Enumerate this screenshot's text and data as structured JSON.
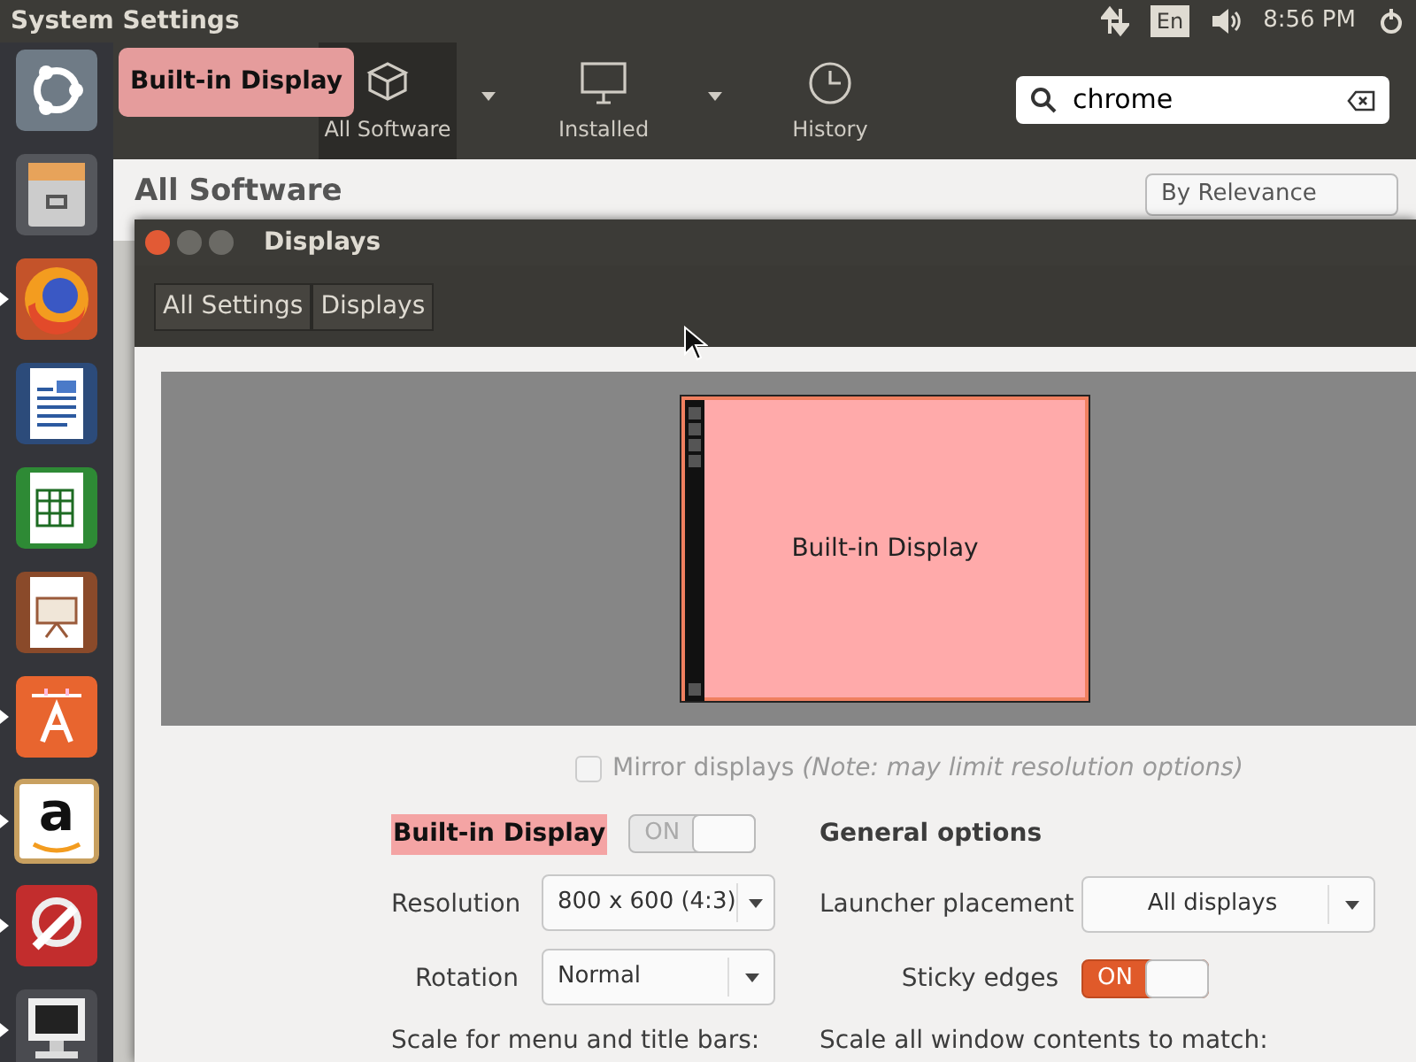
{
  "top_panel": {
    "title": "System Settings",
    "keyboard_layout": "En",
    "time": "8:56 PM"
  },
  "launcher": {
    "items": [
      {
        "kind": "dash",
        "running": false
      },
      {
        "kind": "files",
        "running": false
      },
      {
        "kind": "browser",
        "running": true
      },
      {
        "kind": "writer",
        "running": false
      },
      {
        "kind": "calc",
        "running": false
      },
      {
        "kind": "impress",
        "running": false
      },
      {
        "kind": "software",
        "running": true
      },
      {
        "kind": "shop",
        "glyph": "a",
        "running": true
      },
      {
        "kind": "settings",
        "running": true
      },
      {
        "kind": "display",
        "running": true
      }
    ]
  },
  "software_center": {
    "tooltip": "Built-in Display",
    "toolbar": [
      {
        "label": "All Software",
        "has_menu": true,
        "selected": true
      },
      {
        "label": "Installed",
        "has_menu": true,
        "selected": false
      },
      {
        "label": "History",
        "has_menu": false,
        "selected": false
      }
    ],
    "search": {
      "value": "chrome"
    },
    "heading": "All Software",
    "sort": "By Relevance"
  },
  "displays_window": {
    "title": "Displays",
    "breadcrumbs": [
      "All Settings",
      "Displays"
    ],
    "preview": {
      "monitors": [
        {
          "name": "Built-in Display"
        }
      ]
    },
    "mirror": {
      "label": "Mirror displays *(Note: may limit resolution options)*",
      "checked": false,
      "disabled": true
    },
    "display_settings": {
      "name": "Built-in Display",
      "switch": {
        "label": "ON",
        "on": true,
        "disabled": true
      },
      "rows": [
        {
          "label": "Resolution",
          "value": "800 x 600 (4:3)"
        },
        {
          "label": "Rotation",
          "value": "Normal"
        }
      ],
      "scale_label": "Scale for menu and title bars:"
    },
    "general_options": {
      "title": "General options",
      "launcher_placement": {
        "label": "Launcher placement",
        "value": "All displays"
      },
      "sticky_edges": {
        "label": "Sticky edges",
        "switch": {
          "label": "ON",
          "on": true,
          "disabled": false
        }
      },
      "scale_label": "Scale all window contents to match:"
    }
  }
}
